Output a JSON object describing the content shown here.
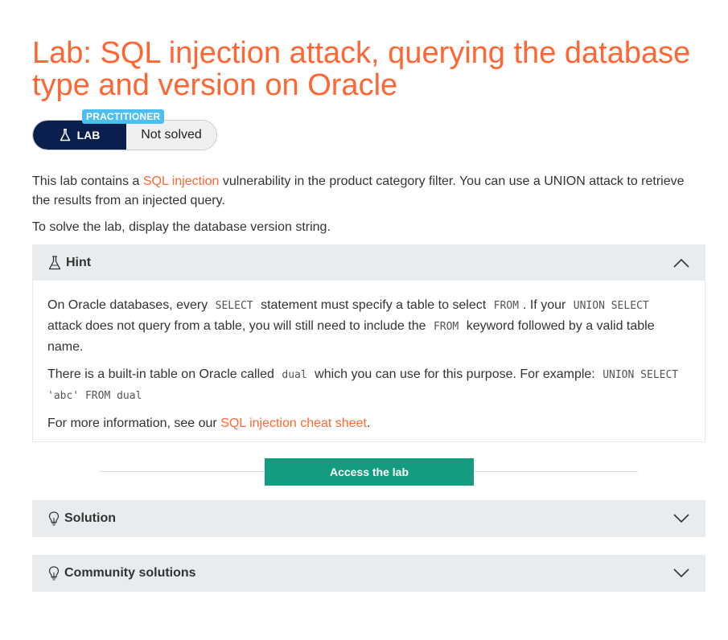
{
  "header": {
    "title": "Lab: SQL injection attack, querying the database type and version on Oracle"
  },
  "badge": {
    "level": "PRACTITIONER",
    "lab_label": "LAB",
    "status": "Not solved"
  },
  "intro": {
    "p1_before": "This lab contains a ",
    "p1_link": "SQL injection",
    "p1_after": " vulnerability in the product category filter. You can use a UNION attack to retrieve the results from an injected query.",
    "p2": "To solve the lab, display the database version string."
  },
  "hint": {
    "title": "Hint",
    "b1_t1": "On Oracle databases, every ",
    "b1_c1": "SELECT",
    "b1_t2": " statement must specify a table to select ",
    "b1_c2": "FROM",
    "b1_t3": ". If your ",
    "b1_c3": "UNION SELECT",
    "b1_t4": " attack does not query from a table, you will still need to include the ",
    "b1_c4": "FROM",
    "b1_t5": " keyword followed by a valid table name.",
    "b2_t1": "There is a built-in table on Oracle called ",
    "b2_c1": "dual",
    "b2_t2": " which you can use for this purpose. For example: ",
    "b2_c2": "UNION SELECT 'abc' FROM dual",
    "b3_t1": "For more information, see our ",
    "b3_link": "SQL injection cheat sheet",
    "b3_t2": "."
  },
  "access_button": "Access the lab",
  "solution": {
    "title": "Solution"
  },
  "community": {
    "title": "Community solutions"
  },
  "colors": {
    "accent": "#ff6633",
    "button": "#149c7f",
    "lab_badge": "#0a1f4d",
    "level_badge": "#4dbef0"
  }
}
